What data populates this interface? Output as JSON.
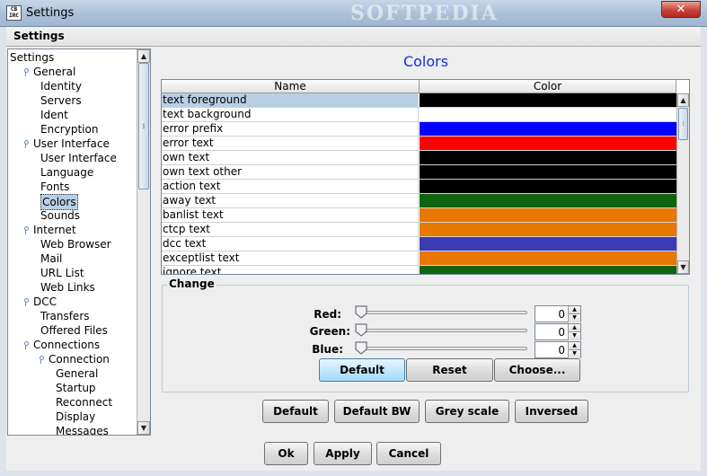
{
  "window": {
    "title": "Settings",
    "icon_text": "CB IRC",
    "watermark": "SOFTPEDIA",
    "close_glyph": "✕"
  },
  "menubar": {
    "settings_menu": "Settings"
  },
  "tree": {
    "items": [
      {
        "label": "Settings",
        "level": 0,
        "handle": false
      },
      {
        "label": "General",
        "level": 1,
        "handle": true
      },
      {
        "label": "Identity",
        "level": 2,
        "handle": false
      },
      {
        "label": "Servers",
        "level": 2,
        "handle": false
      },
      {
        "label": "Ident",
        "level": 2,
        "handle": false
      },
      {
        "label": "Encryption",
        "level": 2,
        "handle": false
      },
      {
        "label": "User Interface",
        "level": 1,
        "handle": true
      },
      {
        "label": "User Interface",
        "level": 2,
        "handle": false
      },
      {
        "label": "Language",
        "level": 2,
        "handle": false
      },
      {
        "label": "Fonts",
        "level": 2,
        "handle": false
      },
      {
        "label": "Colors",
        "level": 2,
        "handle": false,
        "selected": true
      },
      {
        "label": "Sounds",
        "level": 2,
        "handle": false
      },
      {
        "label": "Internet",
        "level": 1,
        "handle": true
      },
      {
        "label": "Web Browser",
        "level": 2,
        "handle": false
      },
      {
        "label": "Mail",
        "level": 2,
        "handle": false
      },
      {
        "label": "URL List",
        "level": 2,
        "handle": false
      },
      {
        "label": "Web Links",
        "level": 2,
        "handle": false
      },
      {
        "label": "DCC",
        "level": 1,
        "handle": true
      },
      {
        "label": "Transfers",
        "level": 2,
        "handle": false
      },
      {
        "label": "Offered Files",
        "level": 2,
        "handle": false
      },
      {
        "label": "Connections",
        "level": 1,
        "handle": true
      },
      {
        "label": "Connection",
        "level": 2,
        "handle": true
      },
      {
        "label": "General",
        "level": 3,
        "handle": false
      },
      {
        "label": "Startup",
        "level": 3,
        "handle": false
      },
      {
        "label": "Reconnect",
        "level": 3,
        "handle": false
      },
      {
        "label": "Display",
        "level": 3,
        "handle": false
      },
      {
        "label": "Messages",
        "level": 3,
        "handle": false
      }
    ]
  },
  "panel": {
    "title": "Colors"
  },
  "table": {
    "columns": [
      "Name",
      "Color"
    ],
    "rows": [
      {
        "name": "text foreground",
        "color": "#000000",
        "selected": true
      },
      {
        "name": "text background",
        "color": "#ffffff"
      },
      {
        "name": "error prefix",
        "color": "#0000ff"
      },
      {
        "name": "error text",
        "color": "#ff0000"
      },
      {
        "name": "own text",
        "color": "#000000"
      },
      {
        "name": "own text other",
        "color": "#000000"
      },
      {
        "name": "action text",
        "color": "#000000"
      },
      {
        "name": "away text",
        "color": "#0f640f"
      },
      {
        "name": "banlist text",
        "color": "#e87800"
      },
      {
        "name": "ctcp text",
        "color": "#e87800"
      },
      {
        "name": "dcc text",
        "color": "#3a3ab4"
      },
      {
        "name": "exceptlist text",
        "color": "#e87800"
      },
      {
        "name": "ignore text",
        "color": "#0f640f"
      }
    ]
  },
  "change": {
    "legend": "Change",
    "red_label": "Red:",
    "green_label": "Green:",
    "blue_label": "Blue:",
    "red_value": "0",
    "green_value": "0",
    "blue_value": "0",
    "default_button": "Default",
    "reset_button": "Reset",
    "choose_button": "Choose..."
  },
  "presets": {
    "default": "Default",
    "default_bw": "Default BW",
    "grey_scale": "Grey scale",
    "inversed": "Inversed"
  },
  "footer": {
    "ok": "Ok",
    "apply": "Apply",
    "cancel": "Cancel"
  }
}
